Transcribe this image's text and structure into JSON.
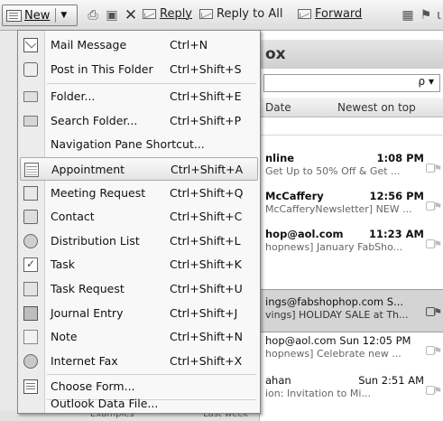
{
  "toolbar": {
    "new_label": "New",
    "reply_label": "Reply",
    "reply_all_label": "Reply to All",
    "forward_label": "Forward"
  },
  "inbox": {
    "title_fragment": "ox",
    "search_arrow": "ρ ▾",
    "col_date": "Date",
    "col_sort": "Newest on top",
    "messages": [
      {
        "line1": "nline",
        "time": "1:08 PM",
        "line2": "Get Up to 50% Off & Get ..."
      },
      {
        "line1": "McCaffery",
        "time": "12:56 PM",
        "line2": "McCafferyNewsletter] NEW ..."
      },
      {
        "line1": "hop@aol.com",
        "time": "11:23 AM",
        "line2": "hopnews] January FabSho..."
      },
      {
        "line1": "ings@fabshophop.com  S...",
        "time": "",
        "line2": "vings] HOLIDAY SALE at Th..."
      },
      {
        "line1": "hop@aol.com  Sun 12:05 PM",
        "time": "",
        "line2": "hopnews] Celebrate new ..."
      },
      {
        "line1": "ahan",
        "time": "Sun 2:51 AM",
        "line2": "ion: Invitation to Mi..."
      }
    ]
  },
  "bottom_nav": {
    "left": "Examples",
    "right": "Last week"
  },
  "menu": {
    "items": [
      {
        "label": "Mail Message",
        "shortcut": "Ctrl+N"
      },
      {
        "label": "Post in This Folder",
        "shortcut": "Ctrl+Shift+S"
      },
      {
        "label": "Folder...",
        "shortcut": "Ctrl+Shift+E"
      },
      {
        "label": "Search Folder...",
        "shortcut": "Ctrl+Shift+P"
      },
      {
        "label": "Navigation Pane Shortcut...",
        "shortcut": ""
      },
      {
        "label": "Appointment",
        "shortcut": "Ctrl+Shift+A"
      },
      {
        "label": "Meeting Request",
        "shortcut": "Ctrl+Shift+Q"
      },
      {
        "label": "Contact",
        "shortcut": "Ctrl+Shift+C"
      },
      {
        "label": "Distribution List",
        "shortcut": "Ctrl+Shift+L"
      },
      {
        "label": "Task",
        "shortcut": "Ctrl+Shift+K"
      },
      {
        "label": "Task Request",
        "shortcut": "Ctrl+Shift+U"
      },
      {
        "label": "Journal Entry",
        "shortcut": "Ctrl+Shift+J"
      },
      {
        "label": "Note",
        "shortcut": "Ctrl+Shift+N"
      },
      {
        "label": "Internet Fax",
        "shortcut": "Ctrl+Shift+X"
      },
      {
        "label": "Choose Form...",
        "shortcut": ""
      },
      {
        "label": "Outlook Data File...",
        "shortcut": ""
      }
    ],
    "highlighted_index": 5
  }
}
